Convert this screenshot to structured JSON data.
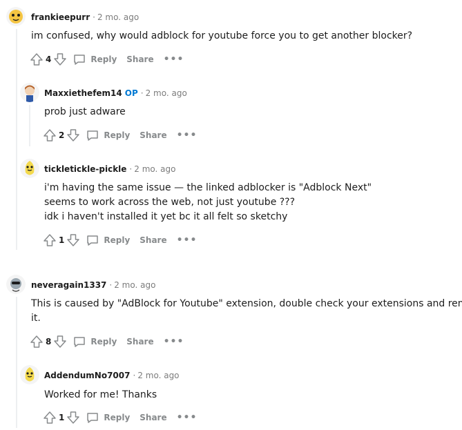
{
  "actions": {
    "reply": "Reply",
    "share": "Share",
    "more": "•••"
  },
  "comments": [
    {
      "author": "frankieepurr",
      "op_badge": "",
      "time": "2 mo. ago",
      "lines": [
        "im confused, why would adblock for youtube force you to get another blocker?"
      ],
      "votes": "4",
      "avatar_color": "#f5c542"
    },
    {
      "author": "Maxxiethefem14",
      "op_badge": "OP",
      "time": "2 mo. ago",
      "lines": [
        "prob just adware"
      ],
      "votes": "2",
      "avatar_color": "#d98b4a"
    },
    {
      "author": "tickletickle-pickle",
      "op_badge": "",
      "time": "2 mo. ago",
      "lines": [
        "i'm having the same issue — the linked adblocker is \"Adblock Next\"",
        "seems to work across the web, not just youtube ???",
        "idk i haven't installed it yet bc it all felt so sketchy"
      ],
      "votes": "1",
      "avatar_color": "#f3d94c"
    },
    {
      "author": "neveragain1337",
      "op_badge": "",
      "time": "2 mo. ago",
      "lines": [
        "This is caused by \"AdBlock for Youtube\" extension, double check your extensions and remove",
        "it."
      ],
      "votes": "8",
      "avatar_color": "#9aa7b0"
    },
    {
      "author": "AddendumNo7007",
      "op_badge": "",
      "time": "2 mo. ago",
      "lines": [
        "Worked for me! Thanks"
      ],
      "votes": "1",
      "avatar_color": "#f3d94c"
    }
  ]
}
